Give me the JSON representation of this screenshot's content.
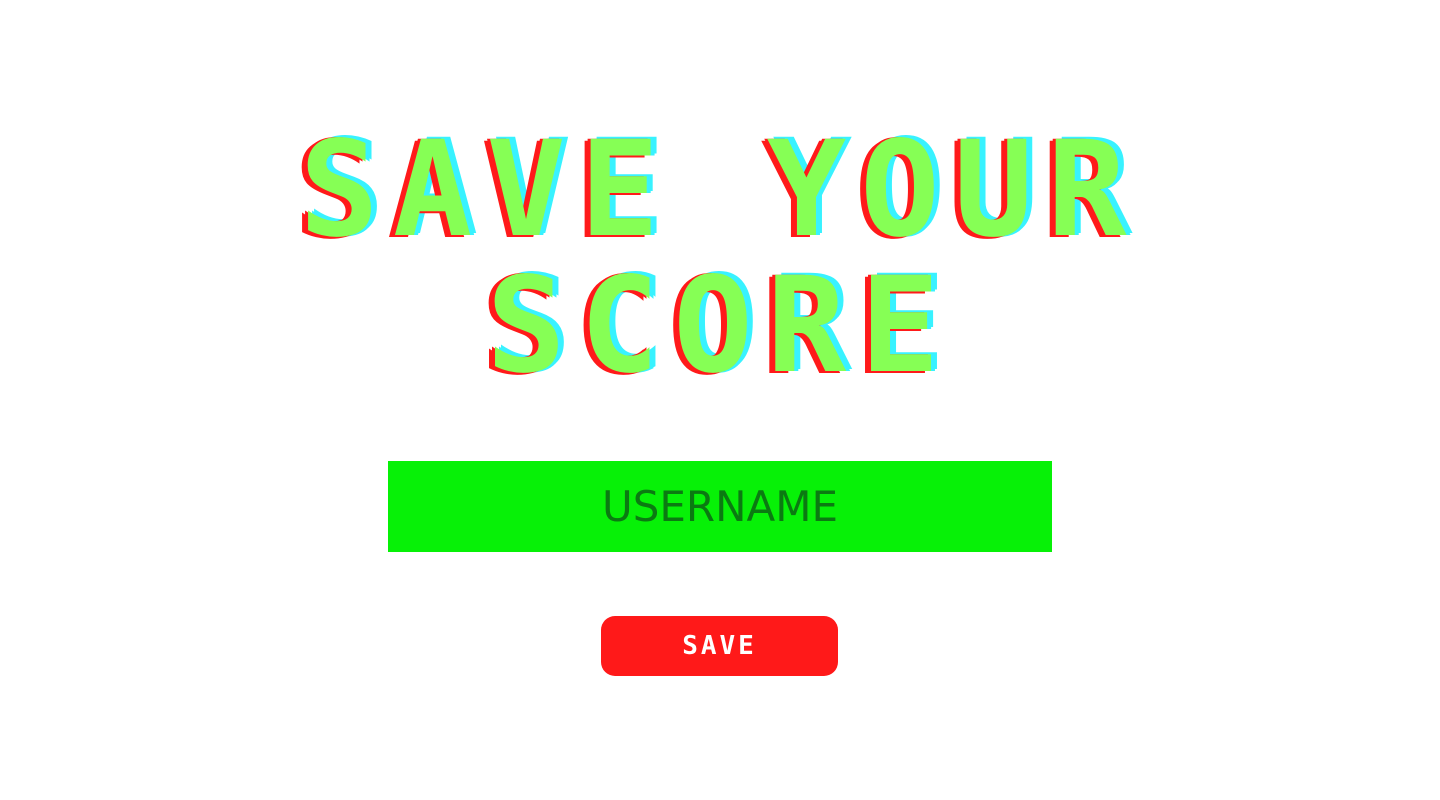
{
  "title": {
    "line1": "SAVE YOUR",
    "line2": "SCORE"
  },
  "username": {
    "placeholder": "USERNAME",
    "value": ""
  },
  "save_button": {
    "label": "SAVE"
  },
  "colors": {
    "background": "#ffffff",
    "title_fill": "#86ff55",
    "title_shadow_red": "#ff1a1a",
    "title_shadow_cyan": "#38f2ff",
    "input_background": "#07f107",
    "input_text": "#0b7a12",
    "button_background": "#ff1919",
    "button_text": "#ffffff"
  }
}
